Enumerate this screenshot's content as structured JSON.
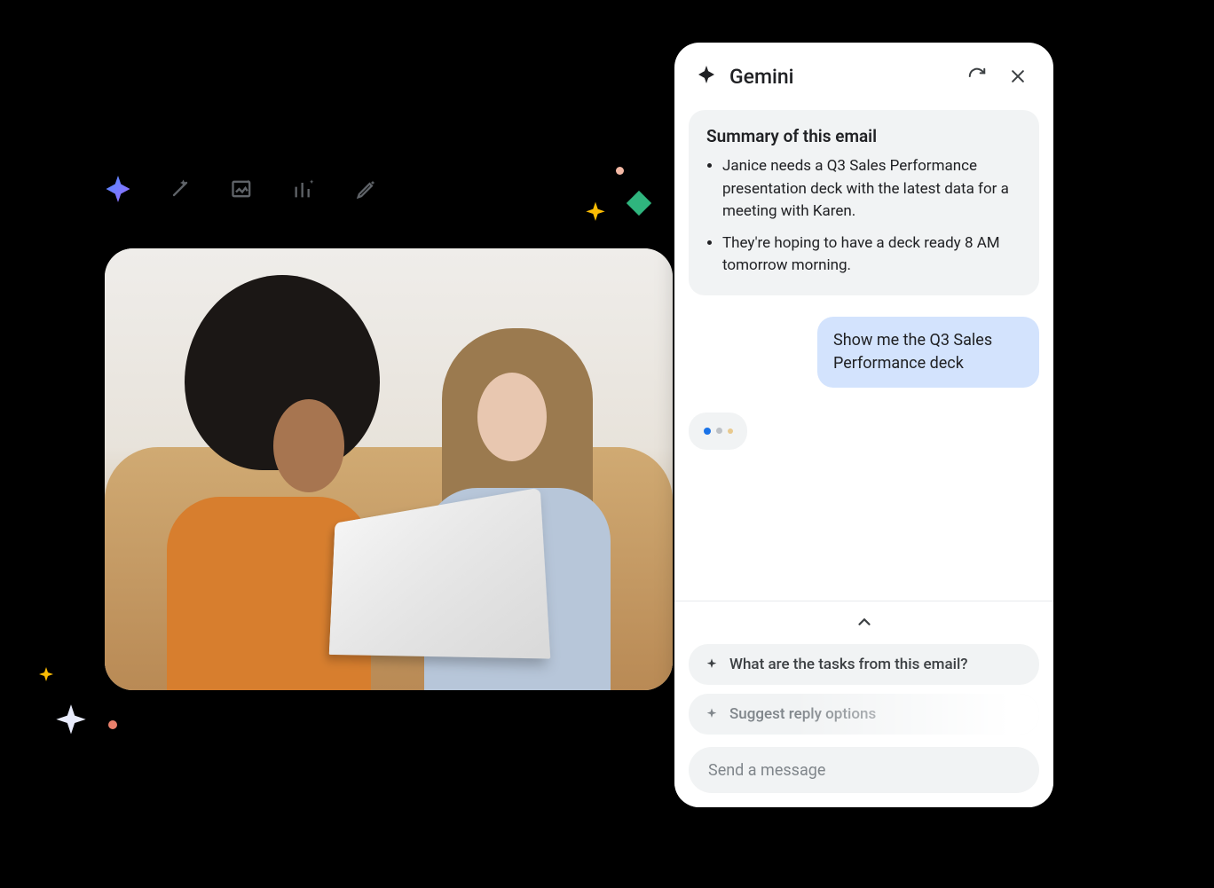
{
  "panel": {
    "title": "Gemini",
    "summary": {
      "heading": "Summary of this email",
      "bullets": [
        "Janice needs a Q3 Sales Performance presentation deck with the latest data for a meeting with Karen.",
        "They're hoping to have a deck ready 8 AM tomorrow morning."
      ]
    },
    "user_message": "Show me the Q3 Sales Performance deck",
    "suggestions": [
      "What are the tasks from this email?",
      "Suggest reply options"
    ],
    "input_placeholder": "Send a message"
  },
  "toolbar": {
    "items": [
      {
        "name": "sparkle-gradient-icon"
      },
      {
        "name": "magic-wand-icon"
      },
      {
        "name": "magic-image-icon"
      },
      {
        "name": "magic-chart-icon"
      },
      {
        "name": "magic-pen-icon"
      }
    ]
  },
  "decor": {
    "sparkle_colors": {
      "blue": "#5b8def",
      "yellow": "#fbbc04",
      "green": "#34a06b",
      "lilac": "#e8ebfb",
      "peach": "#f5b9a8",
      "coral": "#e88a7d"
    }
  }
}
